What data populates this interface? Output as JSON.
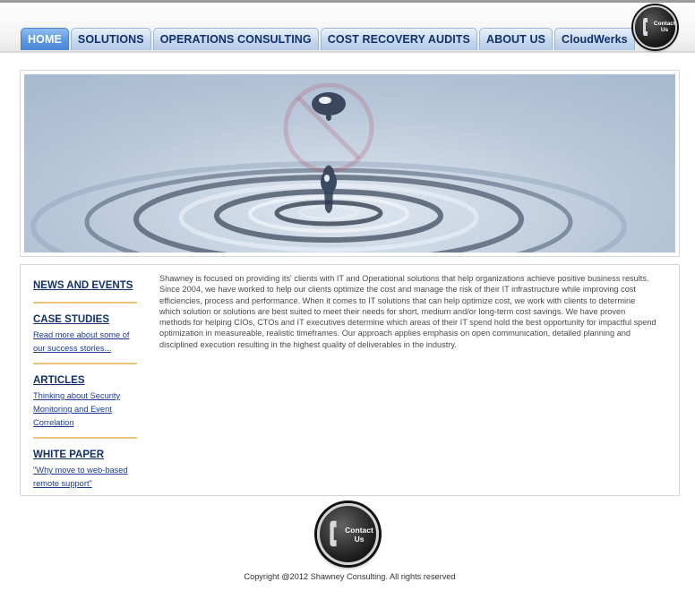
{
  "nav": {
    "tabs": [
      {
        "label": "HOME"
      },
      {
        "label": "SOLUTIONS"
      },
      {
        "label": "OPERATIONS CONSULTING"
      },
      {
        "label": "COST RECOVERY AUDITS"
      },
      {
        "label": "ABOUT US"
      },
      {
        "label": "CloudWerks"
      }
    ],
    "active": "HOME"
  },
  "contact_badge": {
    "line1": "Contact",
    "line2": "Us",
    "icon": "phone-icon"
  },
  "sidebar": {
    "sections": [
      {
        "heading": "NEWS AND EVENTS",
        "links": []
      },
      {
        "heading": "CASE STUDIES",
        "links": [
          "Read more about some of our success stories..."
        ]
      },
      {
        "heading": "ARTICLES",
        "links": [
          "Thinking about Security Monitoring and Event Correlation"
        ]
      },
      {
        "heading": "WHITE PAPER",
        "links": [
          "\"Why move to web-based remote support\""
        ]
      }
    ]
  },
  "main": {
    "intro": "Shawney is focused on providing its' clients with IT and Operational solutions that help organizations achieve positive business results. Since 2004, we have worked to help our clients optimize the cost and manage the risk of their IT infrastructure while improving cost efficiencies, process and performance. When it comes to IT solutions that can help optimize cost, we work with clients to determine which solution or solutions are best suited to meet their needs for short, medium and/or long-term cost savings. We have proven methods for helping CIOs, CTOs and IT executives determine which areas of their IT spend hold the best opportunity for impactful spend optimization in measureable, realistic timeframes. Our approach applies emphasis on open communication, detailed planning and disciplined execution resulting in the highest quality of deliverables in the industry."
  },
  "footer": {
    "contact": {
      "line1": "Contact",
      "line2": "Us"
    },
    "copyright": "Copyright @2012 Shawney Consulting. All rights reserved"
  },
  "colors": {
    "nav_text": "#12306b",
    "nav_active_bg": "#5b97e2",
    "nav_tab_bg": "#c7d9ee",
    "sidebar_divider": "#f0c37a",
    "link": "#1b3a93"
  }
}
